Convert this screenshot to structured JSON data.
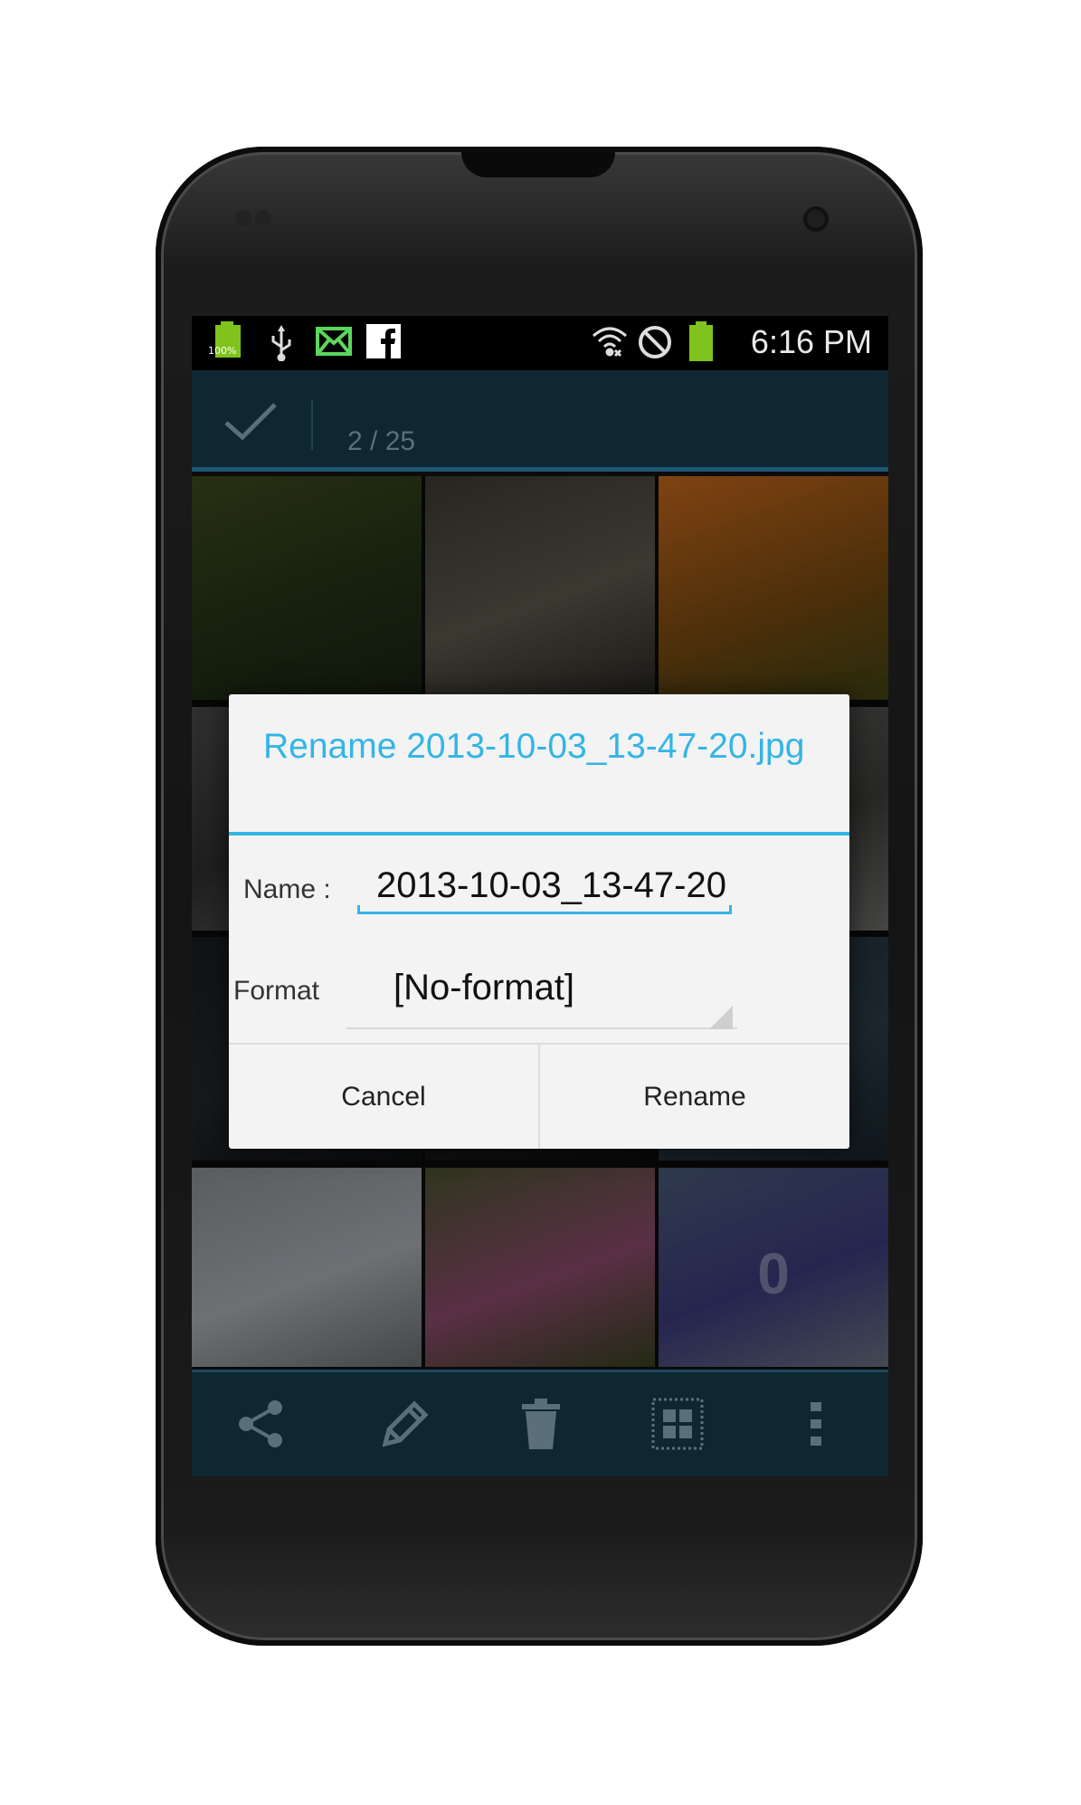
{
  "status_bar": {
    "battery_left_label": "100%",
    "time": "6:16 PM",
    "icons": [
      "battery-icon",
      "usb-icon",
      "mail-icon",
      "facebook-icon",
      "wifi-icon",
      "no-signal-icon",
      "battery-icon"
    ],
    "colors": {
      "accent_green": "#7fc31c",
      "facebook_white": "#ffffff"
    }
  },
  "action_bar": {
    "done_icon": "check-icon",
    "counter": "2 / 25",
    "background": "#0f2731",
    "accent": "#1c5670"
  },
  "gallery": {
    "cells": [
      {
        "subject": "starling bird",
        "colors": [
          "#3e4a1e",
          "#223317",
          "#1a2412"
        ]
      },
      {
        "subject": "horse in field",
        "colors": [
          "#3c3a32",
          "#5a574a",
          "#2a2823"
        ]
      },
      {
        "subject": "sunset wheat field",
        "colors": [
          "#c5671d",
          "#7a4a10",
          "#3f4214"
        ]
      },
      {
        "subject": "grey landscape",
        "colors": [
          "#4a4a4a",
          "#303030",
          "#5c5c5c"
        ]
      },
      {
        "subject": "dark scene",
        "colors": [
          "#1e1e1e",
          "#2a2a2a",
          "#141414"
        ]
      },
      {
        "subject": "birds flock",
        "colors": [
          "#5a5c58",
          "#3c3e3a",
          "#6a6c68"
        ]
      },
      {
        "subject": "night scene",
        "colors": [
          "#1a1d22",
          "#24272c",
          "#101214"
        ]
      },
      {
        "subject": "dark scene",
        "colors": [
          "#141414",
          "#1e1e1e",
          "#0e0e0e"
        ]
      },
      {
        "subject": "stormy sky",
        "colors": [
          "#22313c",
          "#2c3c48",
          "#18242c"
        ]
      },
      {
        "subject": "white mosque",
        "colors": [
          "#8a8f94",
          "#a8adb2",
          "#6a6e72"
        ]
      },
      {
        "subject": "pink flowers",
        "colors": [
          "#4a5230",
          "#8a4a6a",
          "#364020"
        ]
      },
      {
        "subject": "lavender field",
        "colors": [
          "#4a5a78",
          "#3a3a7a",
          "#6a7080"
        ],
        "badge": "0"
      }
    ]
  },
  "dialog": {
    "title": "Rename 2013-10-03_13-47-20.jpg",
    "name_label": "Name :",
    "name_value": "2013-10-03_13-47-20",
    "format_label": "Format",
    "format_value": "[No-format]",
    "cancel_label": "Cancel",
    "rename_label": "Rename",
    "accent": "#33b5e5"
  },
  "bottom_bar": {
    "icons": [
      "share-icon",
      "edit-icon",
      "delete-icon",
      "select-all-icon",
      "overflow-menu-icon"
    ]
  }
}
